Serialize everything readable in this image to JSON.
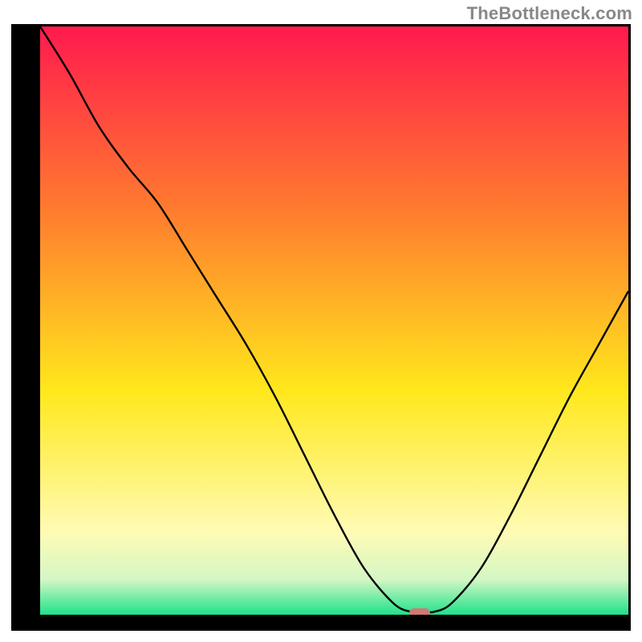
{
  "watermark": "TheBottleneck.com",
  "colors": {
    "frame": "#000000",
    "curve": "#000000",
    "marker": "#cf7a72",
    "gradient_top": "#ff1a4e",
    "gradient_mid1": "#ff7e2e",
    "gradient_mid2": "#ffe81c",
    "gradient_mid3": "#fffbb5",
    "gradient_mid4": "#d4f7c5",
    "gradient_bottom": "#1ee28a"
  },
  "chart_data": {
    "type": "line",
    "title": "",
    "xlabel": "",
    "ylabel": "",
    "xlim": [
      0,
      100
    ],
    "ylim": [
      0,
      100
    ],
    "x": [
      0,
      5,
      10,
      15,
      20,
      25,
      30,
      35,
      40,
      45,
      50,
      55,
      60,
      63,
      65,
      67,
      70,
      75,
      80,
      85,
      90,
      95,
      100
    ],
    "values": [
      100,
      92,
      83,
      76,
      70,
      62,
      54,
      46,
      37,
      27,
      17,
      8,
      2,
      0.5,
      0.5,
      0.5,
      2,
      8,
      17,
      27,
      37,
      46,
      55
    ],
    "min_x": 64,
    "marker": {
      "x": 64.5,
      "y": 0.3
    }
  }
}
